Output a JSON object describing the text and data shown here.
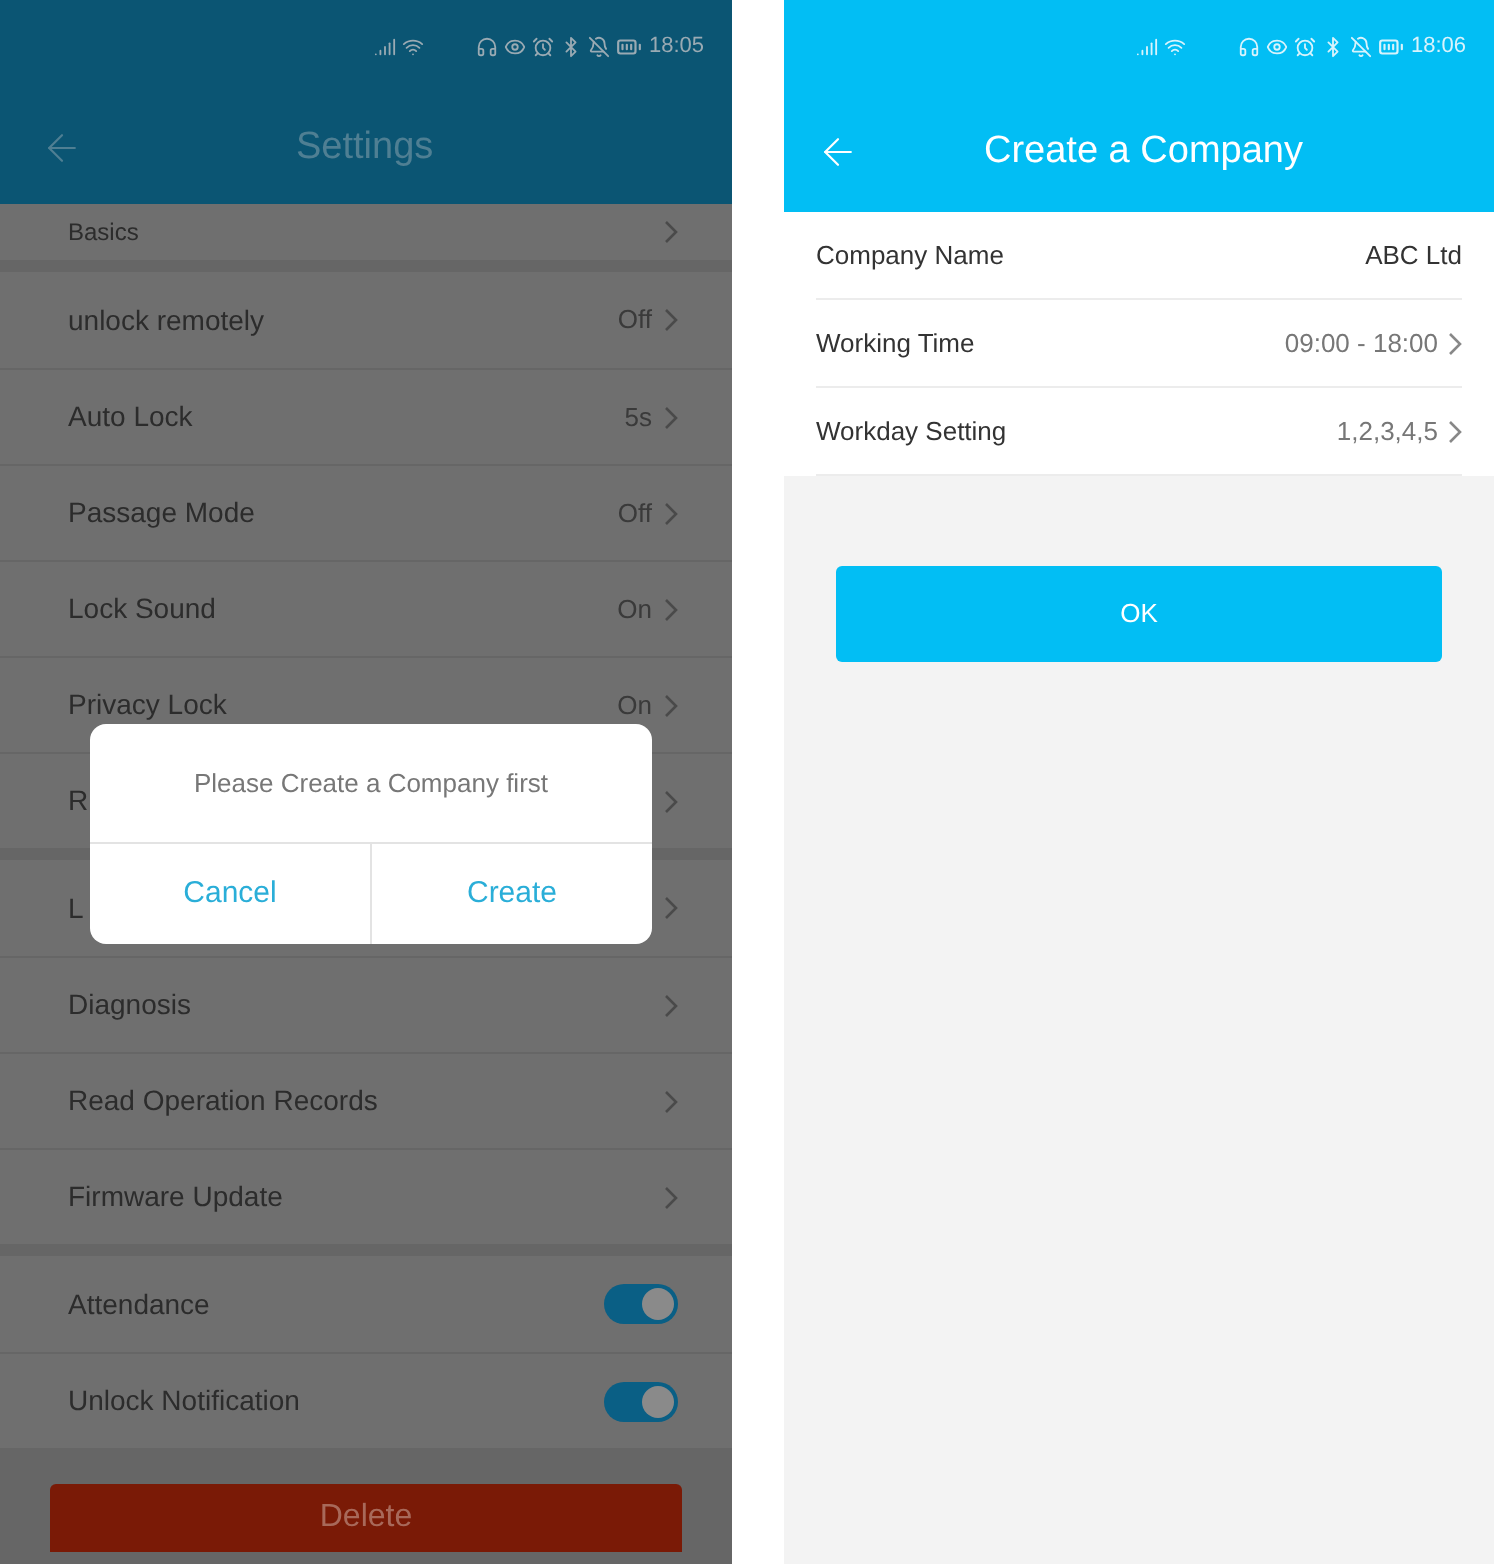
{
  "settings_screen": {
    "status_bar": {
      "time": "18:05"
    },
    "header": {
      "title": "Settings"
    },
    "sections": [
      {
        "items": [
          {
            "kind": "link",
            "label": "Basics"
          }
        ]
      },
      {
        "items": [
          {
            "kind": "link",
            "label": "unlock remotely",
            "value": "Off"
          },
          {
            "kind": "link",
            "label": "Auto Lock",
            "value": "5s"
          },
          {
            "kind": "link",
            "label": "Passage Mode",
            "value": "Off"
          },
          {
            "kind": "link",
            "label": "Lock Sound",
            "value": "On"
          },
          {
            "kind": "link",
            "label": "Privacy Lock",
            "value": "On"
          },
          {
            "kind": "link",
            "label": "R"
          }
        ]
      },
      {
        "items": [
          {
            "kind": "link",
            "label": "L"
          },
          {
            "kind": "link",
            "label": "Diagnosis"
          },
          {
            "kind": "link",
            "label": "Read Operation Records"
          },
          {
            "kind": "link",
            "label": "Firmware Update"
          }
        ]
      },
      {
        "items": [
          {
            "kind": "toggle",
            "label": "Attendance",
            "on": true
          },
          {
            "kind": "toggle",
            "label": "Unlock Notification",
            "on": true
          }
        ]
      }
    ],
    "delete_button": "Delete",
    "dialog": {
      "message": "Please Create a Company first",
      "buttons": [
        "Cancel",
        "Create"
      ]
    }
  },
  "create_company_screen": {
    "status_bar": {
      "time": "18:06"
    },
    "header": {
      "title": "Create a Company"
    },
    "fields": [
      {
        "label": "Company Name",
        "value": "ABC Ltd",
        "chevron": false
      },
      {
        "label": "Working Time",
        "value": "09:00 - 18:00",
        "chevron": true
      },
      {
        "label": "Workday Setting",
        "value": "1,2,3,4,5",
        "chevron": true
      }
    ],
    "ok_button": "OK"
  }
}
